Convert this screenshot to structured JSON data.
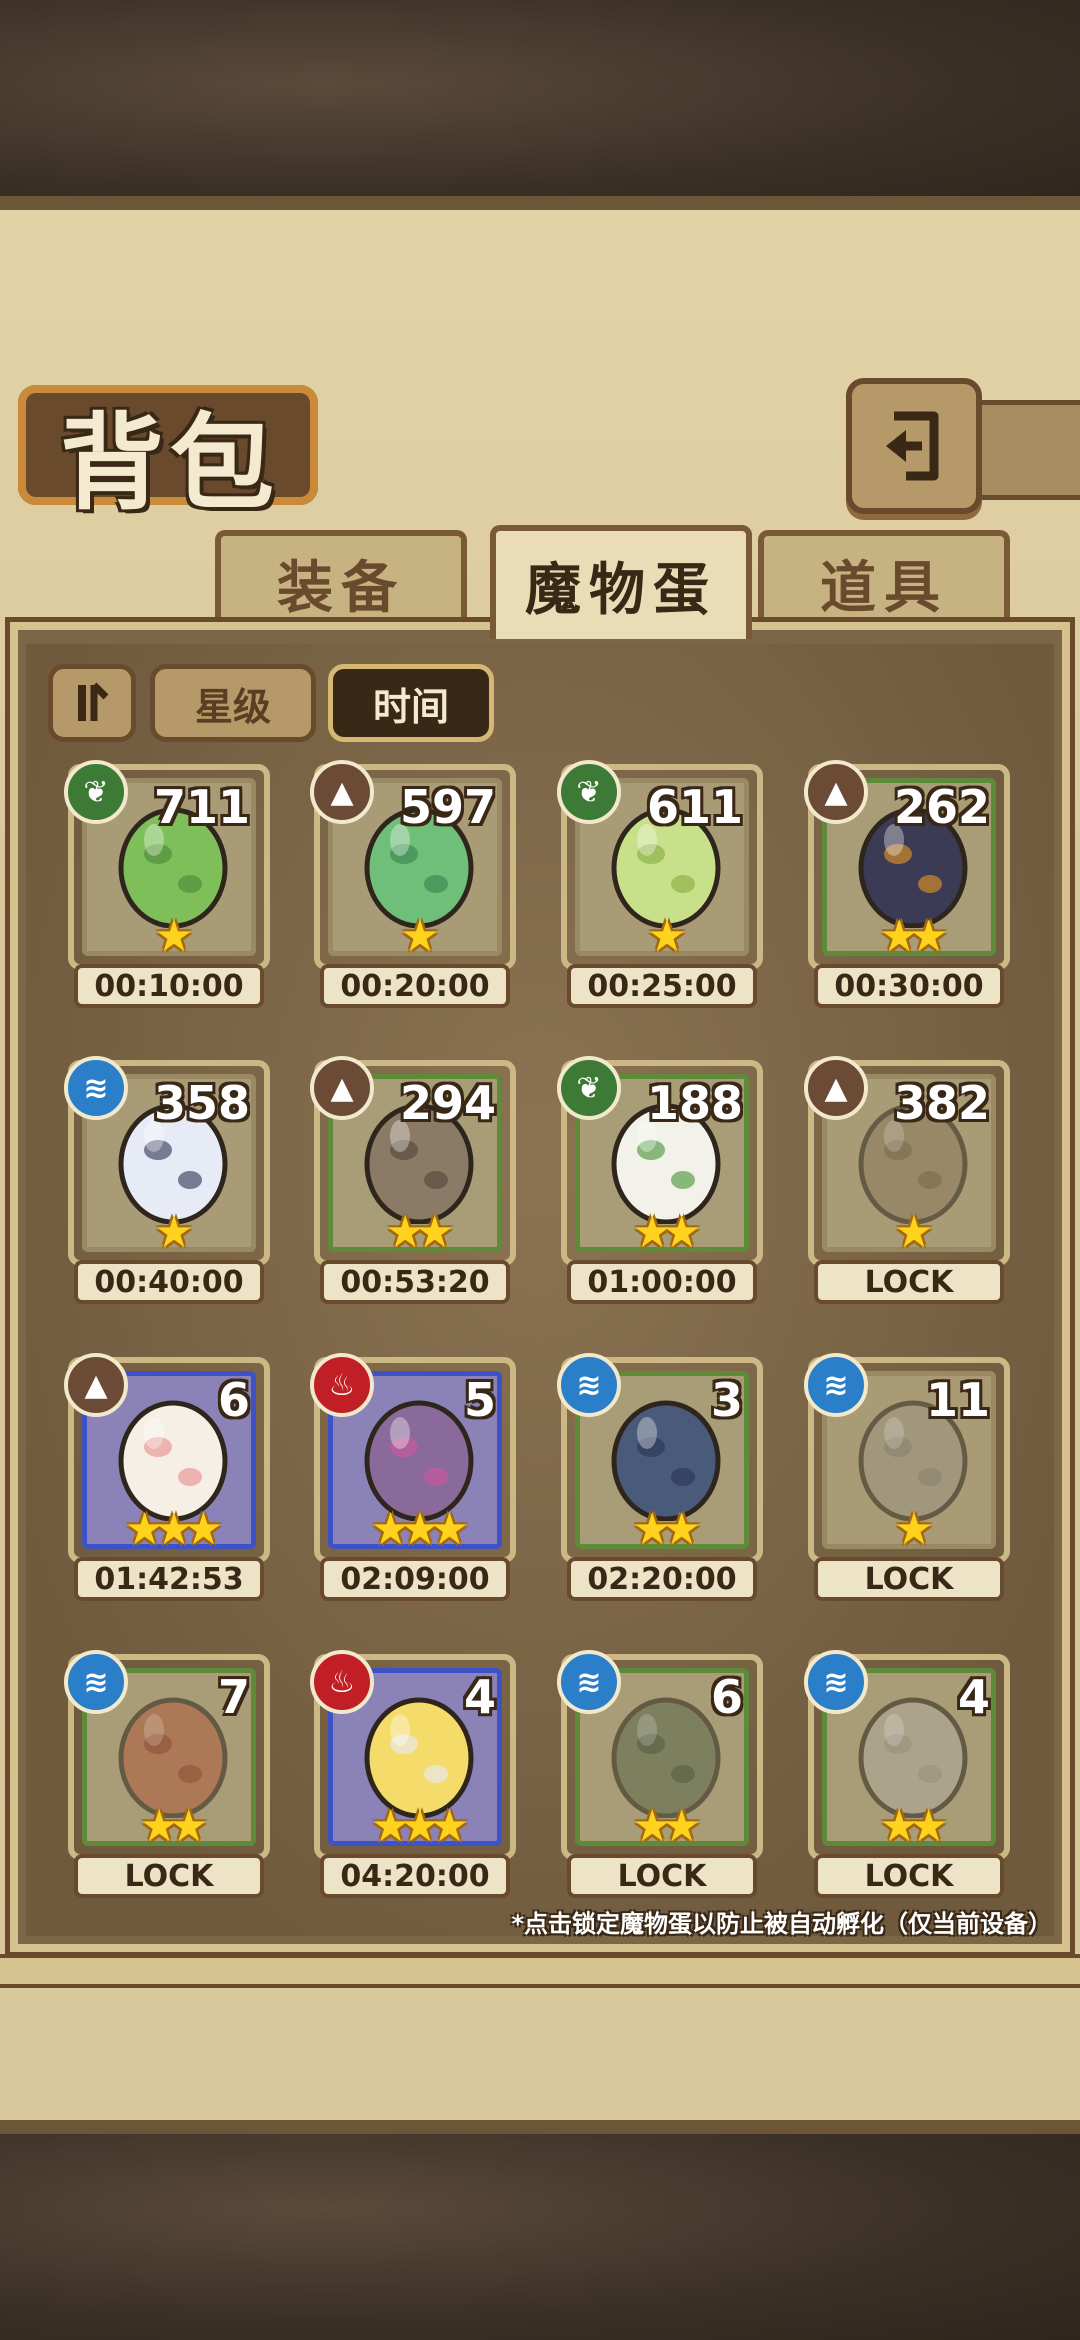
{
  "header": {
    "title": "背包",
    "back_icon": "return-arrow-icon"
  },
  "tabs": [
    {
      "label": "装备",
      "active": false
    },
    {
      "label": "魔物蛋",
      "active": true
    },
    {
      "label": "道具",
      "active": false
    }
  ],
  "filters": {
    "sort_icon": "sort-order-icon",
    "star_label": "星级",
    "time_label": "时间",
    "active": "时间"
  },
  "eggs": [
    {
      "element": "grass",
      "count": "711",
      "stars": 1,
      "timer": "00:10:00",
      "rarity": "plain"
    },
    {
      "element": "earth",
      "count": "597",
      "stars": 1,
      "timer": "00:20:00",
      "rarity": "plain"
    },
    {
      "element": "grass",
      "count": "611",
      "stars": 1,
      "timer": "00:25:00",
      "rarity": "plain"
    },
    {
      "element": "earth",
      "count": "262",
      "stars": 2,
      "timer": "00:30:00",
      "rarity": "green"
    },
    {
      "element": "water",
      "count": "358",
      "stars": 1,
      "timer": "00:40:00",
      "rarity": "plain"
    },
    {
      "element": "earth",
      "count": "294",
      "stars": 2,
      "timer": "00:53:20",
      "rarity": "green"
    },
    {
      "element": "grass",
      "count": "188",
      "stars": 2,
      "timer": "01:00:00",
      "rarity": "green"
    },
    {
      "element": "earth",
      "count": "382",
      "stars": 1,
      "timer": "LOCK",
      "rarity": "plain"
    },
    {
      "element": "earth",
      "count": "6",
      "stars": 3,
      "timer": "01:42:53",
      "rarity": "blue"
    },
    {
      "element": "fire",
      "count": "5",
      "stars": 3,
      "timer": "02:09:00",
      "rarity": "blue"
    },
    {
      "element": "water",
      "count": "3",
      "stars": 2,
      "timer": "02:20:00",
      "rarity": "green"
    },
    {
      "element": "water",
      "count": "11",
      "stars": 1,
      "timer": "LOCK",
      "rarity": "plain"
    },
    {
      "element": "water",
      "count": "7",
      "stars": 2,
      "timer": "LOCK",
      "rarity": "green"
    },
    {
      "element": "fire",
      "count": "4",
      "stars": 3,
      "timer": "04:20:00",
      "rarity": "blue"
    },
    {
      "element": "water",
      "count": "6",
      "stars": 2,
      "timer": "LOCK",
      "rarity": "green"
    },
    {
      "element": "water",
      "count": "4",
      "stars": 2,
      "timer": "LOCK",
      "rarity": "green"
    }
  ],
  "footer_note": "*点击锁定魔物蛋以防止被自动孵化（仅当前设备）",
  "colors": {
    "grass": "#3c7a35",
    "earth": "#6b4a36",
    "water": "#2a7fc8",
    "fire": "#c01f26",
    "star": "#ffd21e"
  }
}
